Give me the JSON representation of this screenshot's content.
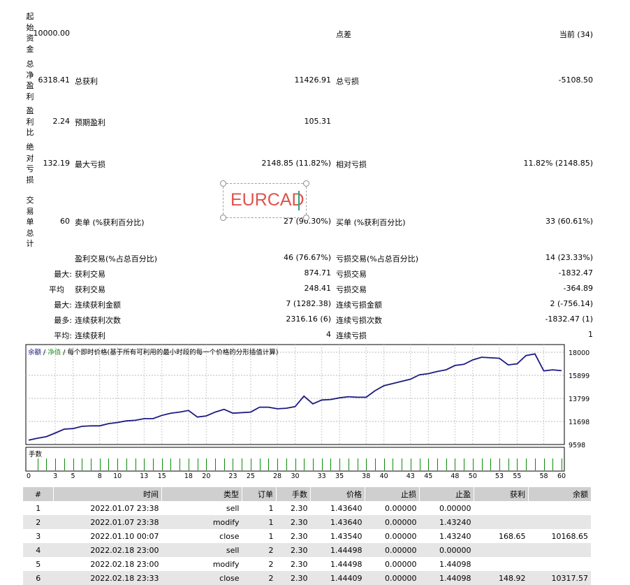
{
  "summary": {
    "initial_deposit_label": "起始资金",
    "initial_deposit": "10000.00",
    "spread_label": "点差",
    "spread": "当前 (34)",
    "net_profit_label": "总净盈利",
    "net_profit": "6318.41",
    "gross_profit_label": "总获利",
    "gross_profit": "11426.91",
    "gross_loss_label": "总亏损",
    "gross_loss": "-5108.50",
    "profit_factor_label": "盈利比",
    "profit_factor": "2.24",
    "expected_payoff_label": "预期盈利",
    "expected_payoff": "105.31",
    "abs_drawdown_label": "绝对亏损",
    "abs_drawdown": "132.19",
    "max_drawdown_label": "最大亏损",
    "max_drawdown": "2148.85 (11.82%)",
    "rel_drawdown_label": "相对亏损",
    "rel_drawdown": "11.82% (2148.85)",
    "total_trades_label": "交易单总计",
    "total_trades": "60",
    "short_label": "卖单 (%获利百分比)",
    "short_value": "27 (96.30%)",
    "long_label": "买单 (%获利百分比)",
    "long_value": "33 (60.61%)",
    "profit_trades_label": "盈利交易(%占总百分比)",
    "profit_trades": "46 (76.67%)",
    "loss_trades_label": "亏损交易(%占总百分比)",
    "loss_trades": "14 (23.33%)",
    "largest_label": "最大:",
    "largest_profit_label": "获利交易",
    "largest_profit": "874.71",
    "largest_loss_label": "亏损交易",
    "largest_loss": "-1832.47",
    "average_label": "平均",
    "average_profit_label": "获利交易",
    "average_profit": "248.41",
    "average_loss_label": "亏损交易",
    "average_loss": "-364.89",
    "max_consec_label": "最大:",
    "max_consec_wins_label": "连续获利金额",
    "max_consec_wins": "7 (1282.38)",
    "max_consec_losses_label": "连续亏损金额",
    "max_consec_losses": "2 (-756.14)",
    "maximal_label": "最多:",
    "maximal_consec_profit_label": "连续获利次数",
    "maximal_consec_profit": "2316.16 (6)",
    "maximal_consec_loss_label": "连续亏损次数",
    "maximal_consec_loss": "-1832.47 (1)",
    "avg_consec_label": "平均:",
    "avg_consec_wins_label": "连续获利",
    "avg_consec_wins": "4",
    "avg_consec_losses_label": "连续亏损",
    "avg_consec_losses": "1"
  },
  "watermark": {
    "text": "EURCAD"
  },
  "chart_data": {
    "type": "line",
    "legend_part1": "余额",
    "legend_sep1": " / ",
    "legend_part2": "净值",
    "legend_rest": " / 每个即时价格(基于所有可利用的最小时段的每一个价格的分形插值计算)",
    "volume_label": "手数",
    "ylim": [
      9598,
      18700
    ],
    "y_ticks": [
      "18000",
      "15899",
      "13799",
      "11698",
      "9598"
    ],
    "y_tick_values": [
      18000,
      15899,
      13799,
      11698,
      9598
    ],
    "x_ticks": [
      "0",
      "3",
      "5",
      "8",
      "10",
      "13",
      "15",
      "18",
      "20",
      "23",
      "25",
      "28",
      "30",
      "33",
      "35",
      "38",
      "40",
      "43",
      "45",
      "48",
      "50",
      "53",
      "55",
      "58",
      "60"
    ],
    "x": [
      0,
      1,
      2,
      3,
      4,
      5,
      6,
      7,
      8,
      9,
      10,
      11,
      12,
      13,
      14,
      15,
      16,
      17,
      18,
      19,
      20,
      21,
      22,
      23,
      25,
      26,
      27,
      28,
      29,
      30,
      31,
      32,
      33,
      34,
      35,
      36,
      37,
      38,
      39,
      40,
      41,
      42,
      43,
      44,
      45,
      46,
      47,
      48,
      49,
      50,
      51,
      52,
      53,
      54,
      55,
      56,
      57,
      58,
      59,
      60
    ],
    "values": [
      10000,
      10168.65,
      10317.57,
      10650,
      11000,
      11050,
      11250,
      11300,
      11300,
      11500,
      11600,
      11750,
      11800,
      11950,
      11950,
      12250,
      12450,
      12550,
      12700,
      12100,
      12200,
      12550,
      12800,
      12450,
      12550,
      13000,
      13000,
      12850,
      12900,
      13050,
      14000,
      13300,
      13650,
      13700,
      13850,
      13950,
      13900,
      13900,
      14500,
      14950,
      15150,
      15350,
      15550,
      15950,
      16050,
      16250,
      16400,
      16800,
      16900,
      17300,
      17550,
      17500,
      17450,
      16850,
      16950,
      17700,
      17850,
      16300,
      16400,
      16318.41
    ],
    "color_balance": "#1a1a80",
    "color_volume": "#0a8a0a",
    "volume_bars": 60
  },
  "trades": {
    "headers": [
      "#",
      "时间",
      "类型",
      "订单",
      "手数",
      "价格",
      "止损",
      "止盈",
      "获利",
      "余额"
    ],
    "rows": [
      [
        "1",
        "2022.01.07 23:38",
        "sell",
        "1",
        "2.30",
        "1.43640",
        "0.00000",
        "0.00000",
        "",
        ""
      ],
      [
        "2",
        "2022.01.07 23:38",
        "modify",
        "1",
        "2.30",
        "1.43640",
        "0.00000",
        "1.43240",
        "",
        ""
      ],
      [
        "3",
        "2022.01.10 00:07",
        "close",
        "1",
        "2.30",
        "1.43540",
        "0.00000",
        "1.43240",
        "168.65",
        "10168.65"
      ],
      [
        "4",
        "2022.02.18 23:00",
        "sell",
        "2",
        "2.30",
        "1.44498",
        "0.00000",
        "0.00000",
        "",
        ""
      ],
      [
        "5",
        "2022.02.18 23:00",
        "modify",
        "2",
        "2.30",
        "1.44498",
        "0.00000",
        "1.44098",
        "",
        ""
      ],
      [
        "6",
        "2022.02.18 23:33",
        "close",
        "2",
        "2.30",
        "1.44409",
        "0.00000",
        "1.44098",
        "148.92",
        "10317.57"
      ]
    ]
  }
}
